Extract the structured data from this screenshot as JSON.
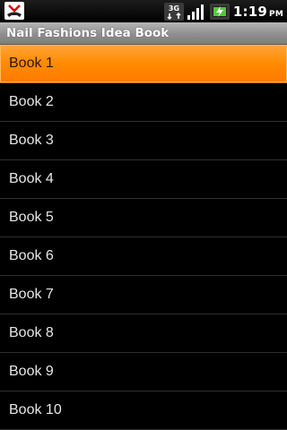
{
  "status_bar": {
    "app_icon": "missed-call-icon",
    "network_label": "3G",
    "time": "1:19",
    "ampm": "PM"
  },
  "title_bar": {
    "title": "Nail Fashions Idea Book"
  },
  "list": {
    "selected_index": 0,
    "items": [
      {
        "label": "Book 1"
      },
      {
        "label": "Book 2"
      },
      {
        "label": "Book 3"
      },
      {
        "label": "Book 4"
      },
      {
        "label": "Book 5"
      },
      {
        "label": "Book 6"
      },
      {
        "label": "Book 7"
      },
      {
        "label": "Book 8"
      },
      {
        "label": "Book 9"
      },
      {
        "label": "Book 10"
      }
    ]
  },
  "colors": {
    "selection": "#ff8a00",
    "background": "#000000",
    "title_bar": "#9a9a9a"
  }
}
